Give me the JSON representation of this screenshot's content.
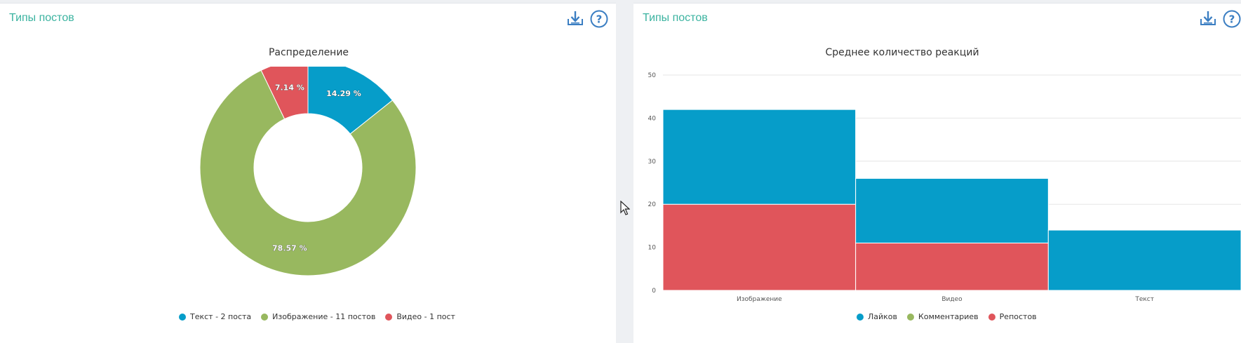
{
  "left_panel": {
    "title": "Типы постов",
    "download_icon": "download-icon",
    "help_icon": "help-icon"
  },
  "right_panel": {
    "title": "Типы постов",
    "download_icon": "download-icon",
    "help_icon": "help-icon"
  },
  "colors": {
    "accent": "#3bb3a0",
    "blue": "#069dc9",
    "green": "#98b85f",
    "red": "#e0555b"
  },
  "chart_data": [
    {
      "type": "pie",
      "title": "Распределение",
      "donut": true,
      "slices": [
        {
          "legend": "Текст - 2 поста",
          "value": 2,
          "label": "14.29 %",
          "color": "#069dc9"
        },
        {
          "legend": "Изображение - 11 постов",
          "value": 11,
          "label": "78.57 %",
          "color": "#98b85f"
        },
        {
          "legend": "Видео - 1 пост",
          "value": 1,
          "label": "7.14 %",
          "color": "#e0555b"
        }
      ],
      "legend_position": "bottom"
    },
    {
      "type": "bar",
      "stacked": true,
      "title": "Среднее количество реакций",
      "categories": [
        "Изображение",
        "Видео",
        "Текст"
      ],
      "series": [
        {
          "name": "Лайков",
          "values": [
            22,
            15,
            14
          ],
          "color": "#069dc9"
        },
        {
          "name": "Комментариев",
          "values": [
            0,
            0,
            0
          ],
          "color": "#98b85f"
        },
        {
          "name": "Репостов",
          "values": [
            20,
            11,
            0
          ],
          "color": "#e0555b"
        }
      ],
      "ylim": [
        0,
        50
      ],
      "yticks": [
        "0",
        "10",
        "20",
        "30",
        "40",
        "50"
      ],
      "grid": true,
      "legend_position": "bottom"
    }
  ]
}
